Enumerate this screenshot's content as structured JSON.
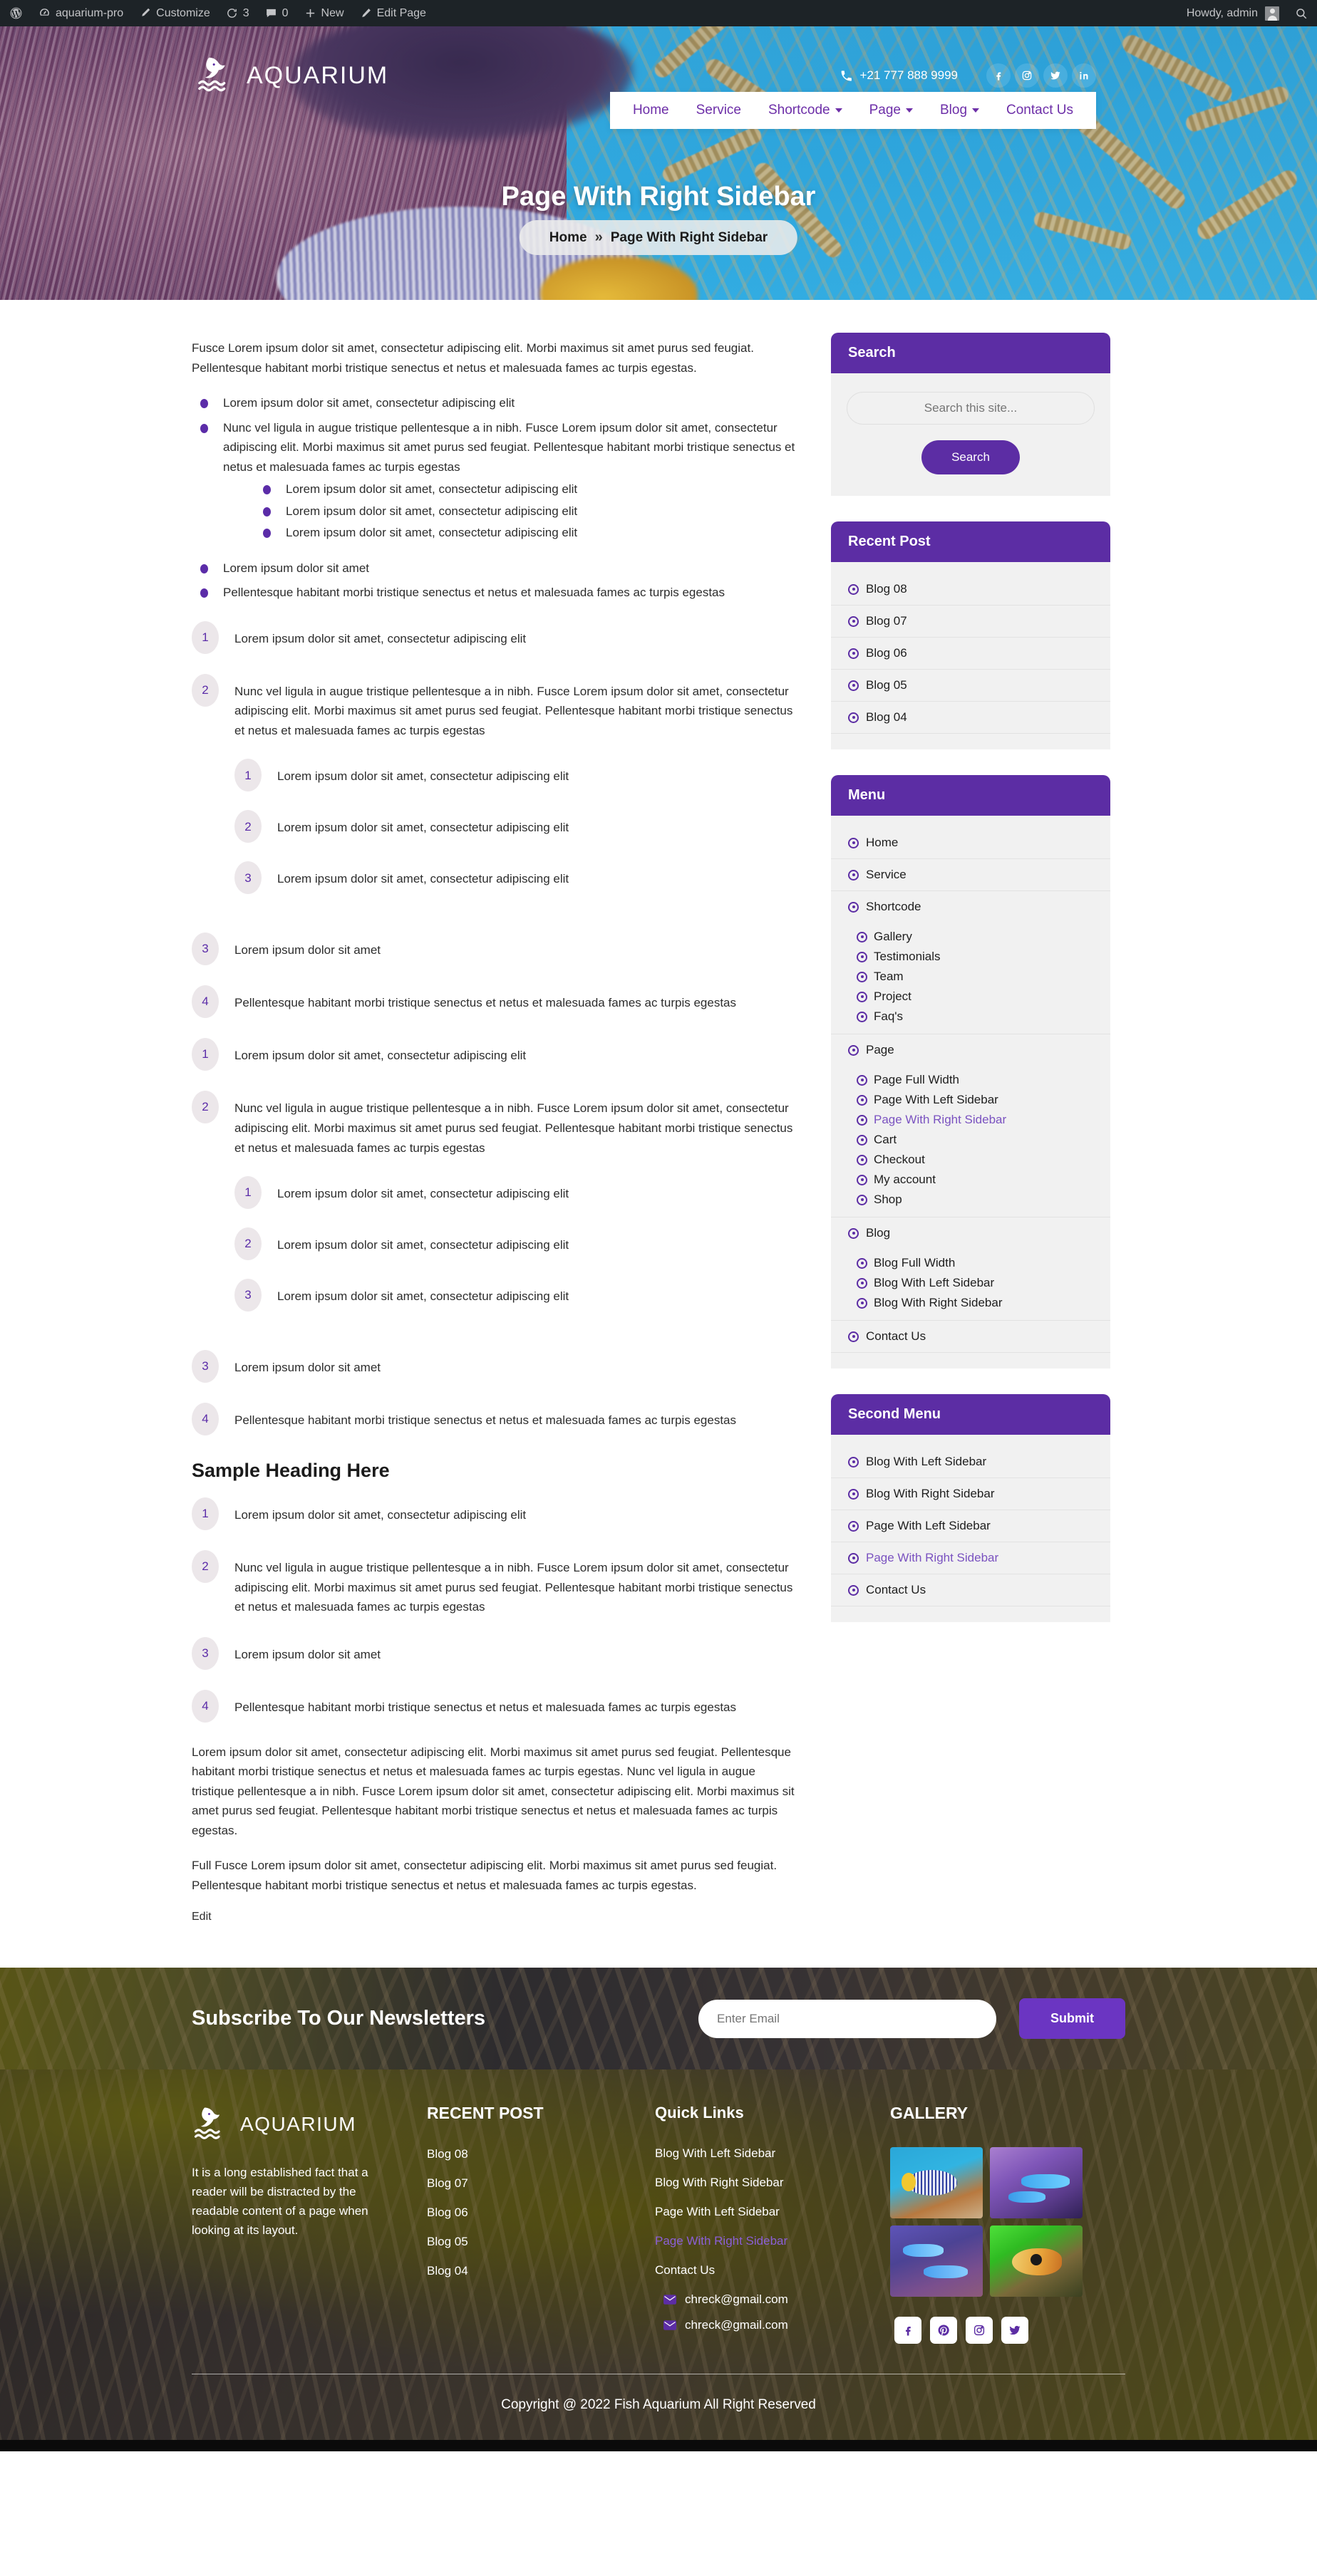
{
  "adminbar": {
    "site_name": "aquarium-pro",
    "customize": "Customize",
    "revisions_count": "3",
    "comments_count": "0",
    "new": "New",
    "edit_page": "Edit Page",
    "howdy": "Howdy, admin"
  },
  "header": {
    "logo_text": "AQUARIUM",
    "phone": "+21 777 888 9999",
    "socials": [
      "facebook-icon",
      "instagram-icon",
      "twitter-icon",
      "linkedin-icon"
    ],
    "nav": [
      {
        "label": "Home",
        "has_caret": false
      },
      {
        "label": "Service",
        "has_caret": false
      },
      {
        "label": "Shortcode",
        "has_caret": true
      },
      {
        "label": "Page",
        "has_caret": true
      },
      {
        "label": "Blog",
        "has_caret": true
      },
      {
        "label": "Contact Us",
        "has_caret": false
      }
    ]
  },
  "hero": {
    "title": "Page With Right Sidebar",
    "breadcrumb_home": "Home",
    "breadcrumb_sep": "»",
    "breadcrumb_current": "Page With Right Sidebar"
  },
  "content": {
    "intro": "Fusce Lorem ipsum dolor sit amet, consectetur adipiscing elit. Morbi maximus sit amet purus sed feugiat. Pellentesque habitant morbi tristique senectus et netus et malesuada fames ac turpis egestas.",
    "bullets": {
      "b1": "Lorem ipsum dolor sit amet, consectetur adipiscing elit",
      "b2": "Nunc vel ligula in augue tristique pellentesque a in nibh. Fusce Lorem ipsum dolor sit amet, consectetur adipiscing elit. Morbi maximus sit amet purus sed feugiat. Pellentesque habitant morbi tristique senectus et netus et malesuada fames ac turpis egestas",
      "n1": "Lorem ipsum dolor sit amet, consectetur adipiscing elit",
      "n2": "Lorem ipsum dolor sit amet, consectetur adipiscing elit",
      "n3": "Lorem ipsum dolor sit amet, consectetur adipiscing elit",
      "b3": "Lorem ipsum dolor sit amet",
      "b4": "Pellentesque habitant morbi tristique senectus et netus et malesuada fames ac turpis egestas"
    },
    "ordered_1": {
      "i1_num": "1",
      "i1": "Lorem ipsum dolor sit amet, consectetur adipiscing elit",
      "i2_num": "2",
      "i2": "Nunc vel ligula in augue tristique pellentesque a in nibh. Fusce Lorem ipsum dolor sit amet, consectetur adipiscing elit. Morbi maximus sit amet purus sed feugiat. Pellentesque habitant morbi tristique senectus et netus et malesuada fames ac turpis egestas",
      "s1_num": "1",
      "s1": "Lorem ipsum dolor sit amet, consectetur adipiscing elit",
      "s2_num": "2",
      "s2": "Lorem ipsum dolor sit amet, consectetur adipiscing elit",
      "s3_num": "3",
      "s3": "Lorem ipsum dolor sit amet, consectetur adipiscing elit",
      "i3_num": "3",
      "i3": "Lorem ipsum dolor sit amet",
      "i4_num": "4",
      "i4": "Pellentesque habitant morbi tristique senectus et netus et malesuada fames ac turpis egestas"
    },
    "ordered_2": {
      "i1_num": "1",
      "i1": "Lorem ipsum dolor sit amet, consectetur adipiscing elit",
      "i2_num": "2",
      "i2": "Nunc vel ligula in augue tristique pellentesque a in nibh. Fusce Lorem ipsum dolor sit amet, consectetur adipiscing elit. Morbi maximus sit amet purus sed feugiat. Pellentesque habitant morbi tristique senectus et netus et malesuada fames ac turpis egestas",
      "s1_num": "1",
      "s1": "Lorem ipsum dolor sit amet, consectetur adipiscing elit",
      "s2_num": "2",
      "s2": "Lorem ipsum dolor sit amet, consectetur adipiscing elit",
      "s3_num": "3",
      "s3": "Lorem ipsum dolor sit amet, consectetur adipiscing elit",
      "i3_num": "3",
      "i3": "Lorem ipsum dolor sit amet",
      "i4_num": "4",
      "i4": "Pellentesque habitant morbi tristique senectus et netus et malesuada fames ac turpis egestas"
    },
    "heading": "Sample Heading Here",
    "ordered_3": {
      "i1_num": "1",
      "i1": "Lorem ipsum dolor sit amet, consectetur adipiscing elit",
      "i2_num": "2",
      "i2": "Nunc vel ligula in augue tristique pellentesque a in nibh. Fusce Lorem ipsum dolor sit amet, consectetur adipiscing elit. Morbi maximus sit amet purus sed feugiat. Pellentesque habitant morbi tristique senectus et netus et malesuada fames ac turpis egestas",
      "i3_num": "3",
      "i3": "Lorem ipsum dolor sit amet",
      "i4_num": "4",
      "i4": "Pellentesque habitant morbi tristique senectus et netus et malesuada fames ac turpis egestas"
    },
    "para_1": "Lorem ipsum dolor sit amet, consectetur adipiscing elit. Morbi maximus sit amet purus sed feugiat. Pellentesque habitant morbi tristique senectus et netus et malesuada fames ac turpis egestas. Nunc vel ligula in augue tristique pellentesque a in nibh. Fusce Lorem ipsum dolor sit amet, consectetur adipiscing elit. Morbi maximus sit amet purus sed feugiat. Pellentesque habitant morbi tristique senectus et netus et malesuada fames ac turpis egestas.",
    "para_2": "Full Fusce Lorem ipsum dolor sit amet, consectetur adipiscing elit. Morbi maximus sit amet purus sed feugiat. Pellentesque habitant morbi tristique senectus et netus et malesuada fames ac turpis egestas.",
    "edit": "Edit"
  },
  "sidebar": {
    "search": {
      "title": "Search",
      "placeholder": "Search this site...",
      "value": "",
      "button": "Search"
    },
    "recent_post": {
      "title": "Recent Post",
      "items": [
        "Blog 08",
        "Blog 07",
        "Blog 06",
        "Blog 05",
        "Blog 04"
      ]
    },
    "menu": {
      "title": "Menu",
      "home": "Home",
      "service": "Service",
      "shortcode": "Shortcode",
      "shortcode_sub": [
        "Gallery",
        "Testimonials",
        "Team",
        "Project",
        "Faq's"
      ],
      "page": "Page",
      "page_sub": [
        "Page Full Width",
        "Page With Left Sidebar",
        "Page With Right Sidebar",
        "Cart",
        "Checkout",
        "My account",
        "Shop"
      ],
      "page_active_index": 2,
      "blog": "Blog",
      "blog_sub": [
        "Blog Full Width",
        "Blog With Left Sidebar",
        "Blog With Right Sidebar"
      ],
      "contact": "Contact Us"
    },
    "second_menu": {
      "title": "Second Menu",
      "items": [
        "Blog With Left Sidebar",
        "Blog With Right Sidebar",
        "Page With Left Sidebar",
        "Page With Right Sidebar",
        "Contact Us"
      ],
      "active_index": 3
    }
  },
  "newsletter": {
    "title": "Subscribe To Our Newsletters",
    "placeholder": "Enter Email",
    "value": "",
    "submit": "Submit"
  },
  "footer": {
    "logo_text": "AQUARIUM",
    "about": "It is a long established fact that a reader will be distracted by the readable content of a page when looking at its layout.",
    "recent_post_title": "RECENT POST",
    "recent_posts": [
      "Blog 08",
      "Blog 07",
      "Blog 06",
      "Blog 05",
      "Blog 04"
    ],
    "quick_links_title": "Quick Links",
    "quick_links": [
      "Blog With Left Sidebar",
      "Blog With Right Sidebar",
      "Page With Left Sidebar",
      "Page With Right Sidebar",
      "Contact Us"
    ],
    "quick_links_active_index": 3,
    "emails": [
      "chreck@gmail.com",
      "chreck@gmail.com"
    ],
    "gallery_title": "GALLERY",
    "gallery_count": 4,
    "socials": [
      "facebook-icon",
      "pinterest-icon",
      "instagram-icon",
      "twitter-icon"
    ],
    "copyright": "Copyright @ 2022 Fish Aquarium All Right Reserved"
  },
  "colors": {
    "brand_purple": "#5c2da4",
    "accent_light_purple": "#7a52c0",
    "submit_purple": "#6b35c2",
    "admin_bar": "#1d2327"
  }
}
